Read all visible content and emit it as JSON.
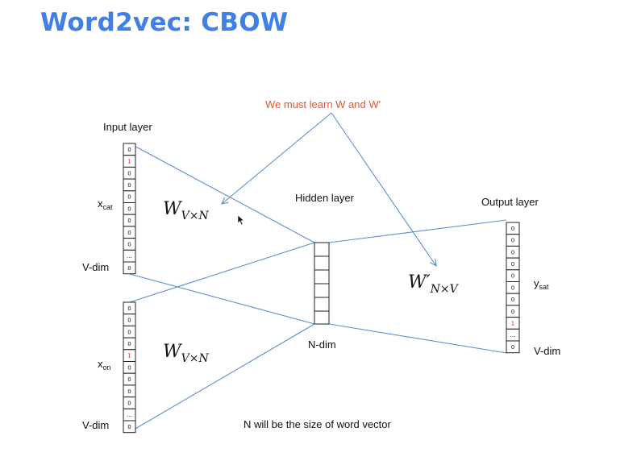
{
  "title": "Word2vec:  CBOW",
  "note": "We must learn W and W'",
  "labels": {
    "input_layer": "Input layer",
    "hidden_layer": "Hidden layer",
    "output_layer": "Output layer",
    "x_cat": "x",
    "x_cat_sub": "cat",
    "x_on": "x",
    "x_on_sub": "on",
    "y_sat": "y",
    "y_sat_sub": "sat",
    "vdim_top": "V-dim",
    "vdim_bottom": "V-dim",
    "vdim_output": "V-dim",
    "ndim": "N-dim",
    "caption": "N will be the size of word vector"
  },
  "weights": {
    "w_top": "W",
    "w_top_sub": "V×N",
    "w_bottom": "W",
    "w_bottom_sub": "V×N",
    "w_out": "W′",
    "w_out_sub": "N×V"
  },
  "vectors": {
    "input_cat": [
      "0",
      "1",
      "0",
      "0",
      "0",
      "0",
      "0",
      "0",
      "0",
      "…",
      "0"
    ],
    "input_on": [
      "0",
      "0",
      "0",
      "0",
      "1",
      "0",
      "0",
      "0",
      "0",
      "…",
      "0"
    ],
    "output_sat": [
      "0",
      "0",
      "0",
      "0",
      "0",
      "0",
      "0",
      "0",
      "1",
      "…",
      "0"
    ],
    "hot_value": "1"
  },
  "colors": {
    "title": "#3f7fe6",
    "note": "#e8552f",
    "lines": "#5b8fcf",
    "hot": "#e02020"
  }
}
